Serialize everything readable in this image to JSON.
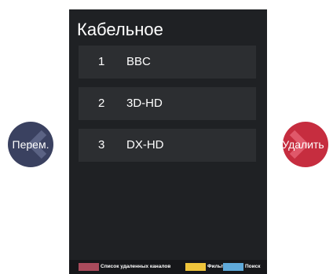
{
  "panel": {
    "title": "Кабельное",
    "channels": [
      {
        "number": "1",
        "name": "BBC"
      },
      {
        "number": "2",
        "name": "3D-HD"
      },
      {
        "number": "3",
        "name": "DX-HD"
      }
    ]
  },
  "nav": {
    "move_label": "Перем.",
    "delete_label": "Удалить"
  },
  "legend": {
    "deleted_channels": "Список удаленных каналов",
    "filter": "Фильтр",
    "search": "Поиск"
  },
  "colors": {
    "panel_bg": "#1f2124",
    "row_bg": "#2c2e31",
    "move_button": "#3a4160",
    "delete_button": "#c62d3f",
    "legend_red": "#a94b5c",
    "legend_yellow": "#efc43b",
    "legend_blue": "#5fa9d9"
  },
  "icons": {
    "move": "chevron-left-icon",
    "delete": "chevron-right-icon"
  }
}
